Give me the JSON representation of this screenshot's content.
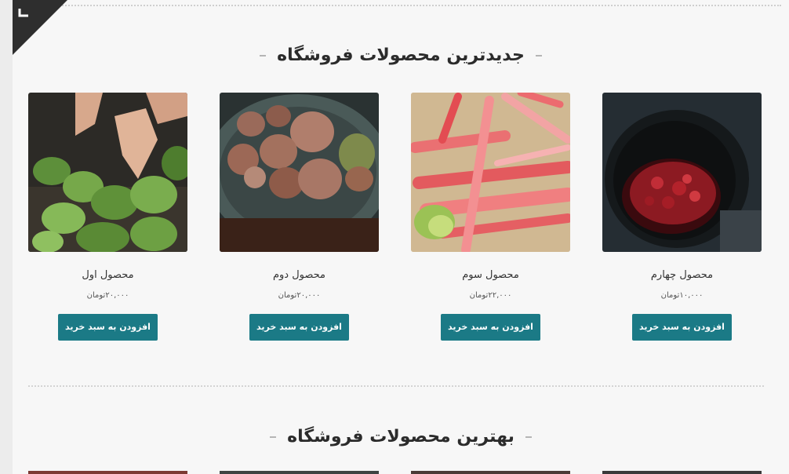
{
  "sections": {
    "newest_title": "جدیدترین محصولات فروشگاه",
    "best_title": "بهترین محصولات فروشگاه"
  },
  "products": [
    {
      "name": "محصول اول",
      "price": "۲۰,۰۰۰تومان",
      "button_label": "افزودن به سبد خرید",
      "image": "seedlings-photo"
    },
    {
      "name": "محصول دوم",
      "price": "۲۰,۰۰۰تومان",
      "button_label": "افزودن به سبد خرید",
      "image": "tubers-photo"
    },
    {
      "name": "محصول سوم",
      "price": "۲۲,۰۰۰تومان",
      "button_label": "افزودن به سبد خرید",
      "image": "rhubarb-photo"
    },
    {
      "name": "محصول چهارم",
      "price": "۱۰,۰۰۰تومان",
      "button_label": "افزودن به سبد خرید",
      "image": "red-sauce-bowl-photo"
    }
  ],
  "colors": {
    "button": "#1b7a86",
    "corner": "#2e2e2e"
  },
  "icons": {
    "corner": "corner-toggle-icon"
  }
}
